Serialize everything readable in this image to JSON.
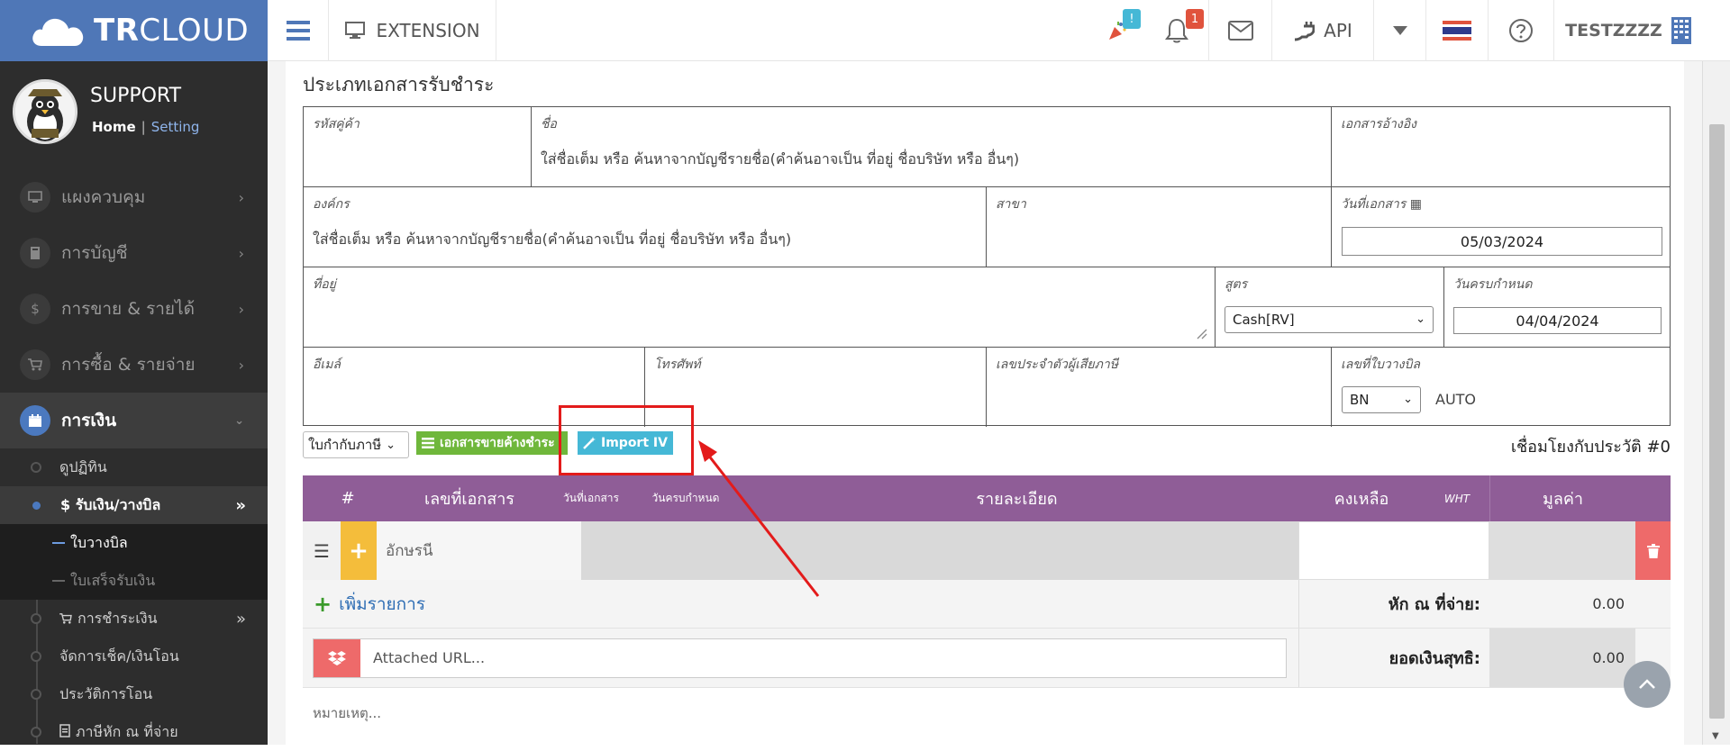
{
  "app": {
    "logo_text_bold": "TR",
    "logo_text_light": "CLOUD"
  },
  "topbar": {
    "extension_label": "EXTENSION",
    "party_badge": "!",
    "notification_badge": "1",
    "api_label": "API",
    "user_label": "TESTZZZZ",
    "icons": [
      "menu-icon",
      "monitor-icon",
      "party-icon",
      "bell-icon",
      "mail-icon",
      "plug-icon",
      "caret-down-icon",
      "thai-flag-icon",
      "help-icon",
      "building-icon"
    ]
  },
  "profile": {
    "name": "SUPPORT",
    "home_link": "Home",
    "separator": "|",
    "setting_link": "Setting"
  },
  "sidebar": {
    "menu": [
      {
        "label": "แผงควบคุม"
      },
      {
        "label": "การบัญชี"
      },
      {
        "label": "การขาย & รายได้"
      },
      {
        "label": "การซื้อ & รายจ่าย"
      },
      {
        "label": "การเงิน"
      }
    ],
    "finance_sub": {
      "calendar": "ดูปฏิทิน",
      "receive": "$ รับเงิน/วางบิล",
      "billing_note": "ใบวางบิล",
      "receipt": "ใบเสร็จรับเงิน",
      "payment": "การชำระเงิน",
      "cheque": "จัดการเช็ค/เงินโอน",
      "transfer_history": "ประวัติการโอน",
      "withholding": "ภาษีหัก ณ ที่จ่าย"
    }
  },
  "page": {
    "title": "ประเภทเอกสารรับชำระ"
  },
  "form": {
    "customer_code_label": "รหัสคู่ค้า",
    "name_label": "ชื่อ",
    "name_placeholder": "ใส่ชื่อเต็ม หรือ ค้นหาจากบัญชีรายชื่อ(คำค้นอาจเป็น ที่อยู่ ชื่อบริษัท หรือ อื่นๆ)",
    "reference_label": "เอกสารอ้างอิง",
    "org_label": "องค์กร",
    "org_placeholder": "ใส่ชื่อเต็ม หรือ ค้นหาจากบัญชีรายชื่อ(คำค้นอาจเป็น ที่อยู่ ชื่อบริษัท หรือ อื่นๆ)",
    "branch_label": "สาขา",
    "doc_date_label": "วันที่เอกสาร",
    "doc_date_value": "05/03/2024",
    "address_label": "ที่อยู่",
    "formula_label": "สูตร",
    "formula_value": "Cash[RV]",
    "due_date_label": "วันครบกำหนด",
    "due_date_value": "04/04/2024",
    "email_label": "อีเมล์",
    "phone_label": "โทรศัพท์",
    "tax_id_label": "เลขประจำตัวผู้เสียภาษี",
    "bill_no_label": "เลขที่ใบวางบิล",
    "bill_prefix_value": "BN",
    "bill_auto": "AUTO"
  },
  "toolbar": {
    "doc_type_select": "ใบกำกับภาษี",
    "pending_button": "เอกสารขายค้างชำระ",
    "import_button": "Import IV",
    "history_link": "เชื่อมโยงกับประวัติ #0"
  },
  "table": {
    "headers": {
      "index": "#",
      "doc_no": "เลขที่เอกสาร",
      "doc_date": "วันที่เอกสาร",
      "due_date": "วันครบกำหนด",
      "detail": "รายละเอียด",
      "balance": "คงเหลือ",
      "wht": "WHT",
      "value": "มูลค่า"
    },
    "row": {
      "code_placeholder": "อักษรนี"
    }
  },
  "summary": {
    "add_line": "เพิ่มรายการ",
    "wht_label": "หัก ณ ที่จ่าย:",
    "wht_value": "0.00",
    "net_label": "ยอดเงินสุทธิ:",
    "net_value": "0.00",
    "attach_placeholder": "Attached URL...",
    "note_placeholder": "หมายเหตุ..."
  },
  "colors": {
    "brand_blue": "#4f77b7",
    "table_header": "#8f5d97",
    "pending_green": "#6fb73b",
    "import_cyan": "#45b8d6",
    "highlight_red": "#e31b1b",
    "add_yellow": "#f4bd3b",
    "delete_red": "#ee6a6a"
  }
}
